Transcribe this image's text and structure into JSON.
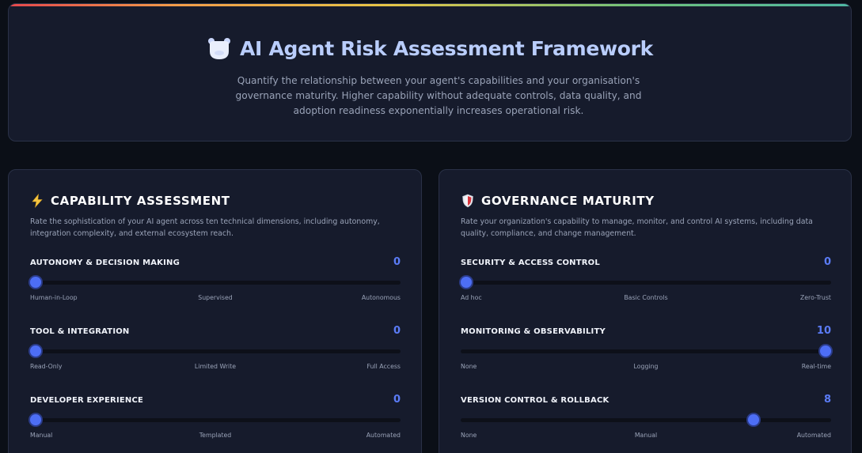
{
  "header": {
    "title": "AI Agent Risk Assessment Framework",
    "subtitle": "Quantify the relationship between your agent's capabilities and your organisation's governance maturity. Higher capability without adequate controls, data quality, and adoption readiness exponentially increases operational risk.",
    "icon": "robot-icon"
  },
  "capability": {
    "title": "CAPABILITY ASSESSMENT",
    "icon": "lightning-icon",
    "description": "Rate the sophistication of your AI agent across ten technical dimensions, including autonomy, integration complexity, and external ecosystem reach.",
    "sliders": [
      {
        "label": "AUTONOMY & DECISION MAKING",
        "value": "0",
        "level": 0,
        "max": 10,
        "ticks": [
          "Human-in-Loop",
          "Supervised",
          "Autonomous"
        ]
      },
      {
        "label": "TOOL & INTEGRATION",
        "value": "0",
        "level": 0,
        "max": 10,
        "ticks": [
          "Read-Only",
          "Limited Write",
          "Full Access"
        ]
      },
      {
        "label": "DEVELOPER EXPERIENCE",
        "value": "0",
        "level": 0,
        "max": 10,
        "ticks": [
          "Manual",
          "Templated",
          "Automated"
        ]
      }
    ]
  },
  "governance": {
    "title": "GOVERNANCE MATURITY",
    "icon": "shield-icon",
    "description": "Rate your organization's capability to manage, monitor, and control AI systems, including data quality, compliance, and change management.",
    "sliders": [
      {
        "label": "SECURITY & ACCESS CONTROL",
        "value": "0",
        "level": 0,
        "max": 10,
        "ticks": [
          "Ad hoc",
          "Basic Controls",
          "Zero-Trust"
        ]
      },
      {
        "label": "MONITORING & OBSERVABILITY",
        "value": "10",
        "level": 10,
        "max": 10,
        "ticks": [
          "None",
          "Logging",
          "Real-time"
        ]
      },
      {
        "label": "VERSION CONTROL & ROLLBACK",
        "value": "8",
        "level": 8,
        "max": 10,
        "ticks": [
          "None",
          "Manual",
          "Automated"
        ]
      }
    ]
  }
}
